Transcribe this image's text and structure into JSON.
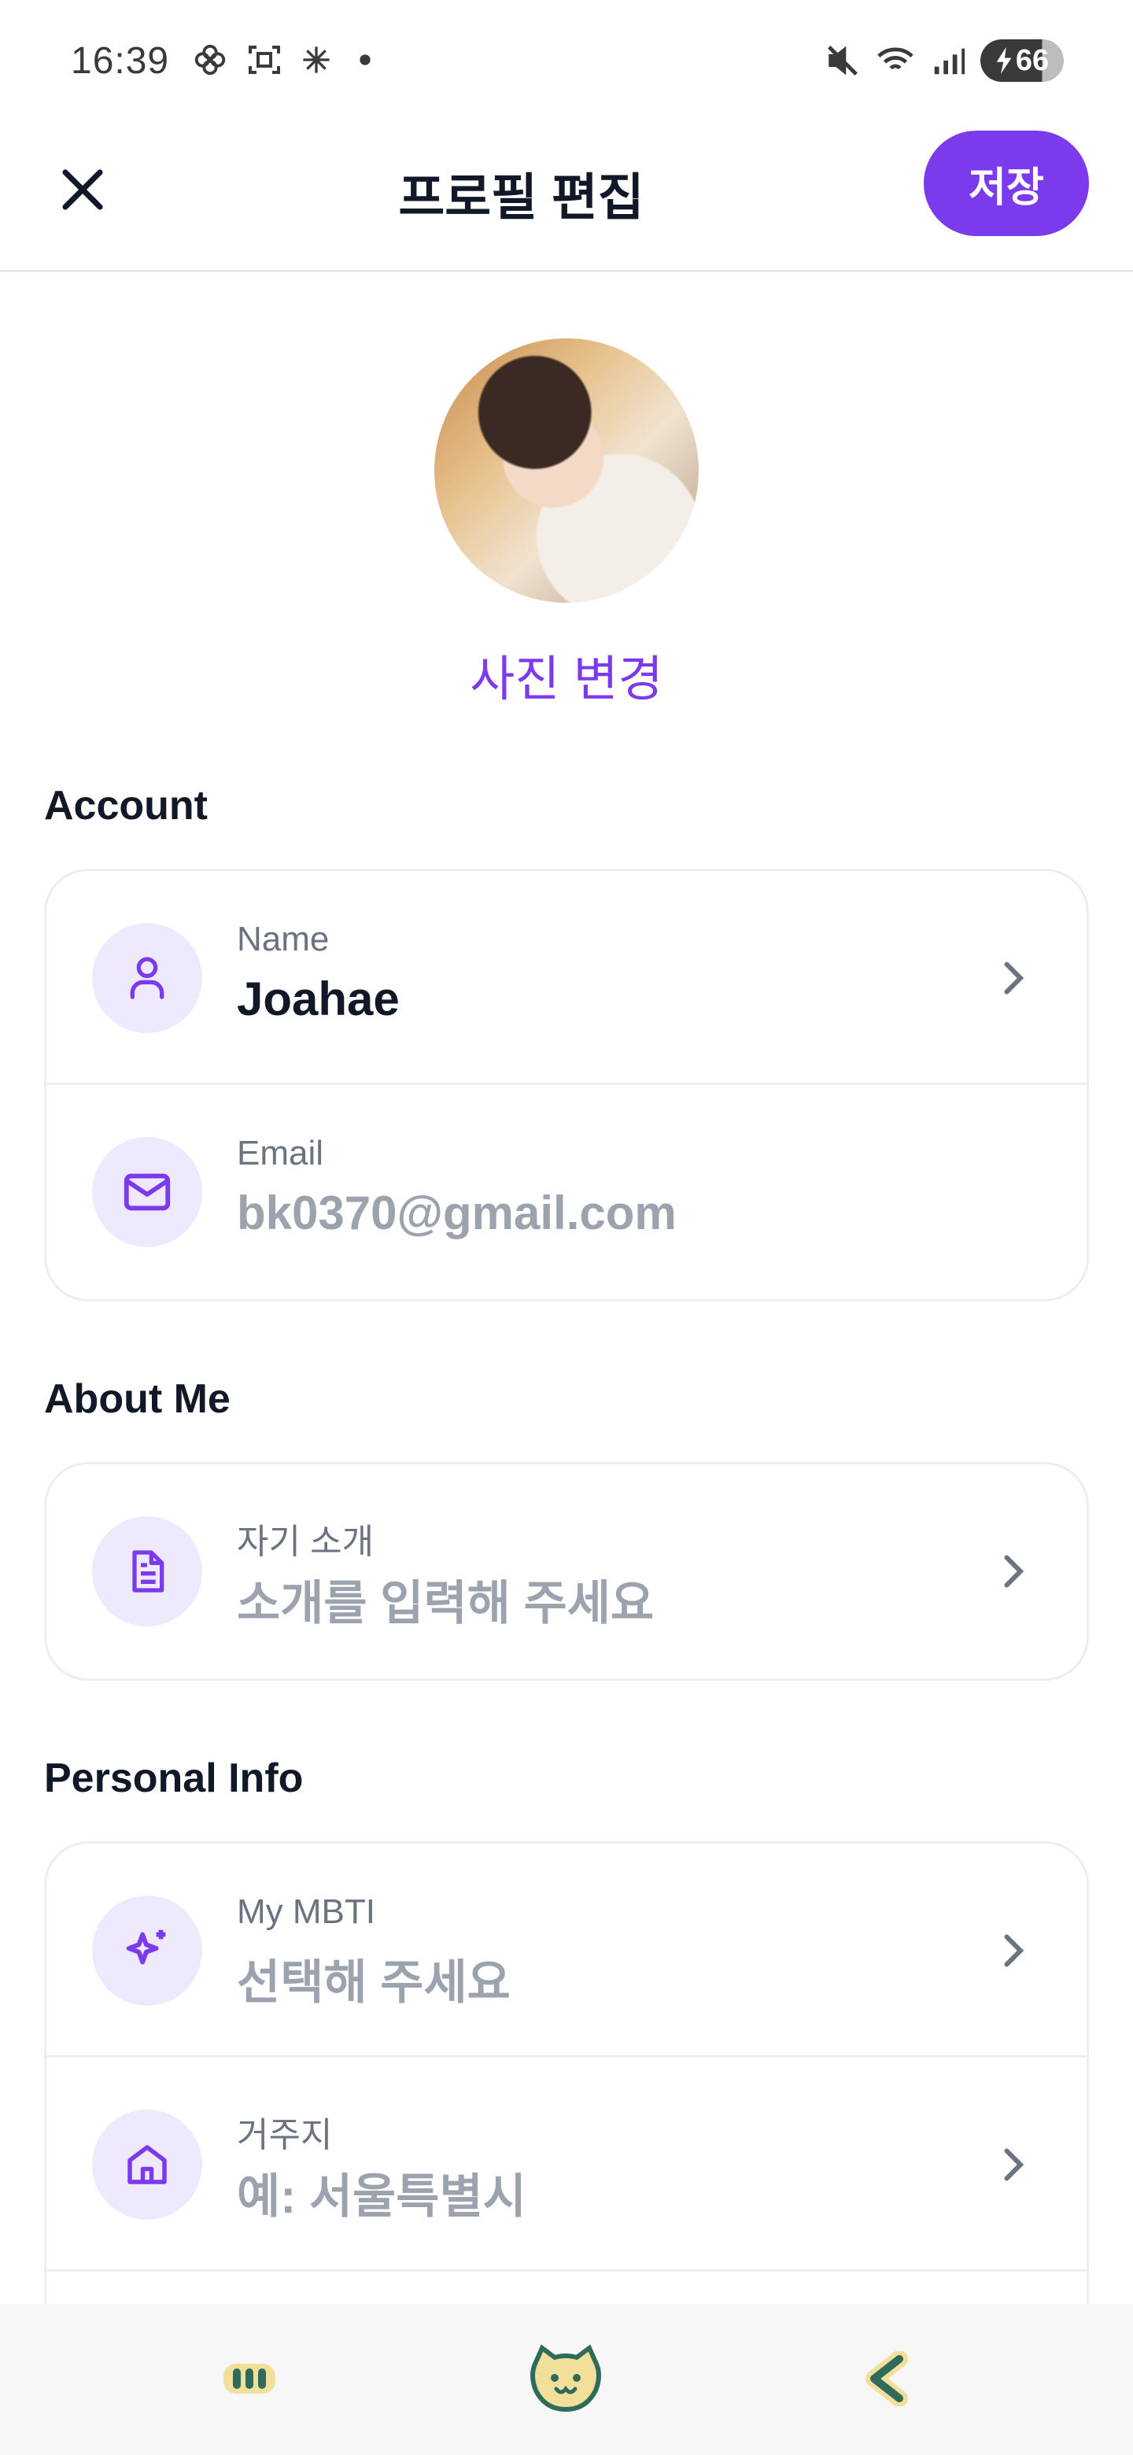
{
  "status_bar": {
    "time": "16:39",
    "battery": "66",
    "icons_left": [
      "flower-icon",
      "screenshot-icon",
      "snowflake-icon",
      "dot-icon"
    ],
    "icons_right": [
      "mute-icon",
      "wifi-icon",
      "signal-icon",
      "battery-icon"
    ]
  },
  "header": {
    "title": "프로필 편집",
    "save_label": "저장"
  },
  "profile": {
    "change_photo_label": "사진 변경"
  },
  "sections": {
    "account": {
      "title": "Account",
      "name_label": "Name",
      "name_value": "Joahae",
      "email_label": "Email",
      "email_value": "bk0370@gmail.com"
    },
    "about": {
      "title": "About Me",
      "intro_label": "자기 소개",
      "intro_placeholder": "소개를 입력해 주세요"
    },
    "personal": {
      "title": "Personal Info",
      "mbti_label": "My MBTI",
      "mbti_placeholder": "선택해 주세요",
      "residence_label": "거주지",
      "residence_placeholder": "예: 서울특별시"
    }
  },
  "colors": {
    "accent": "#7c3aed",
    "icon_bg": "#efe9fd",
    "nav_icon": "#f2df9a",
    "nav_icon_stroke": "#2f6b5a"
  }
}
